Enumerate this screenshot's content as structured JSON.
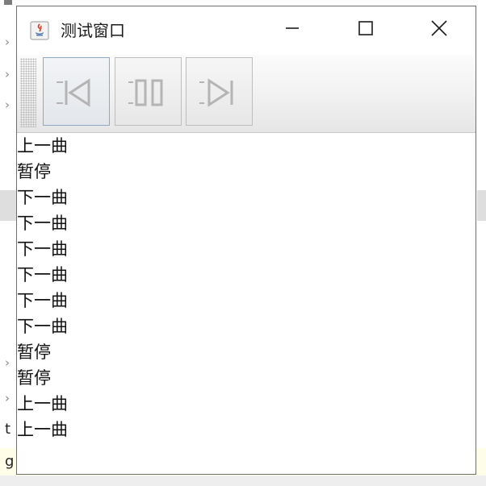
{
  "window": {
    "title": "测试窗口"
  },
  "toolbar": {
    "buttons": [
      {
        "name": "previous",
        "icon": "skip-previous-icon"
      },
      {
        "name": "pause",
        "icon": "pause-icon"
      },
      {
        "name": "next",
        "icon": "skip-next-icon"
      }
    ]
  },
  "list": {
    "items": [
      "上一曲",
      "暂停",
      "下一曲",
      "下一曲",
      "下一曲",
      "下一曲",
      "下一曲",
      "下一曲",
      "暂停",
      "暂停",
      "上一曲",
      "上一曲"
    ]
  },
  "background": {
    "chevron": "›",
    "text_t": "t",
    "text_g": "g"
  },
  "colors": {
    "window_border": "#6e6e6e",
    "button_focus_border": "#8fa8c8",
    "toolbar_bottom": "#e6e6e6"
  }
}
